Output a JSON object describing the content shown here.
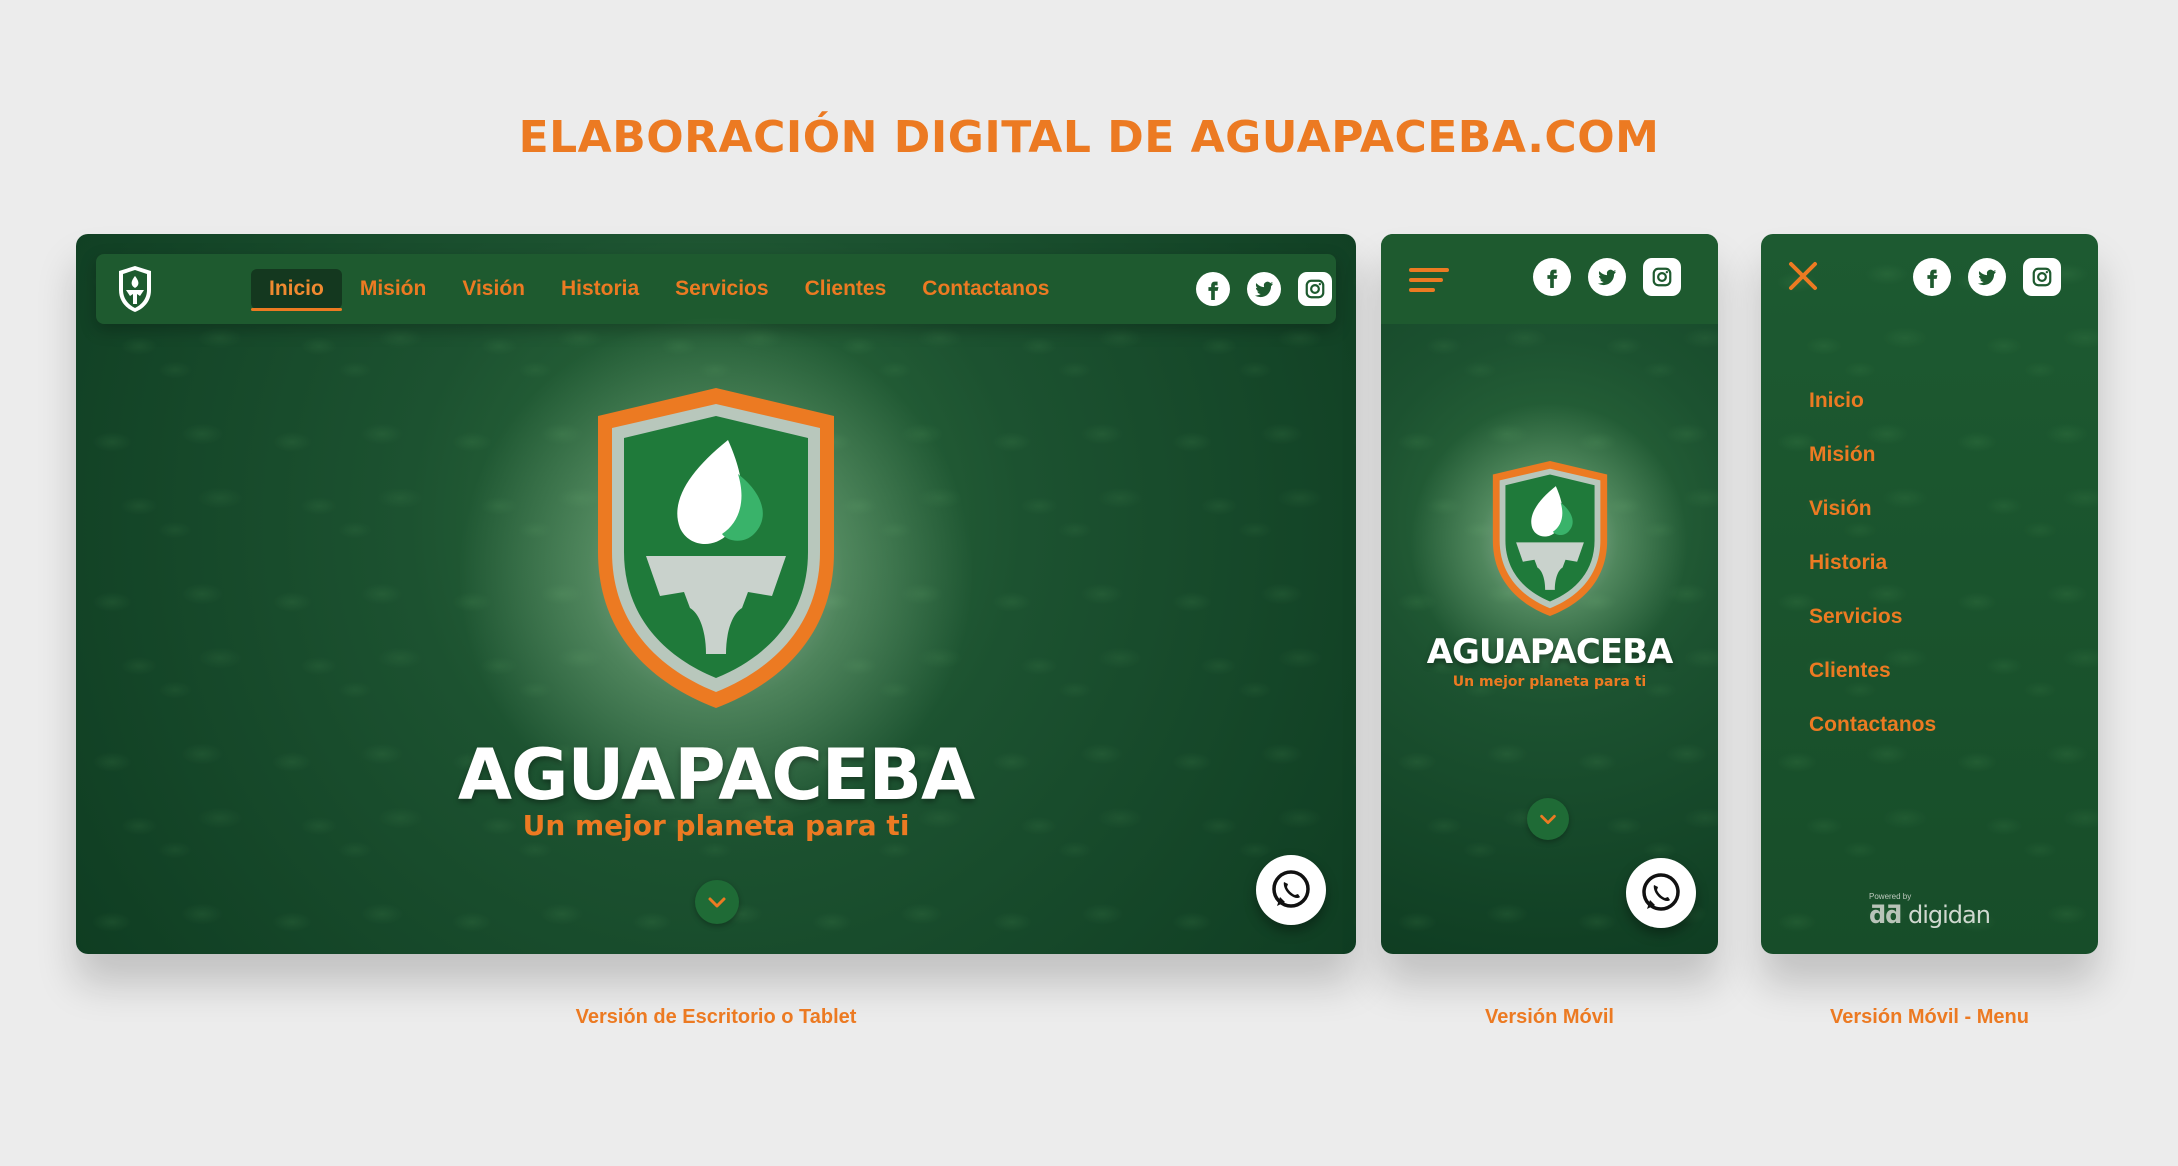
{
  "page": {
    "title": "ELABORACIÓN DIGITAL DE AGUAPACEBA.COM"
  },
  "colors": {
    "accent": "#ec7a22",
    "dark_green": "#0f3d22",
    "nav_green": "#1e5a2f",
    "background": "#ececec"
  },
  "desktop": {
    "nav_items": [
      {
        "label": "Inicio",
        "active": true
      },
      {
        "label": "Misión"
      },
      {
        "label": "Visión"
      },
      {
        "label": "Historia"
      },
      {
        "label": "Servicios"
      },
      {
        "label": "Clientes"
      },
      {
        "label": "Contactanos"
      }
    ],
    "brand": "AGUAPACEBA",
    "tagline": "Un mejor planeta para ti",
    "caption": "Versión de Escritorio o Tablet"
  },
  "mobile": {
    "brand": "AGUAPACEBA",
    "tagline": "Un mejor planeta para ti",
    "caption": "Versión Móvil"
  },
  "mobile_menu": {
    "items": [
      "Inicio",
      "Misión",
      "Visión",
      "Historia",
      "Servicios",
      "Clientes",
      "Contactanos"
    ],
    "powered_by": "Powered by",
    "powered_brand": "digidan",
    "caption": "Versión Móvil - Menu"
  },
  "icons": {
    "social": [
      "facebook-icon",
      "twitter-icon",
      "instagram-icon"
    ],
    "whatsapp": "whatsapp-icon",
    "scroll": "chevron-down-icon",
    "menu": "hamburger-icon",
    "close": "close-icon"
  }
}
